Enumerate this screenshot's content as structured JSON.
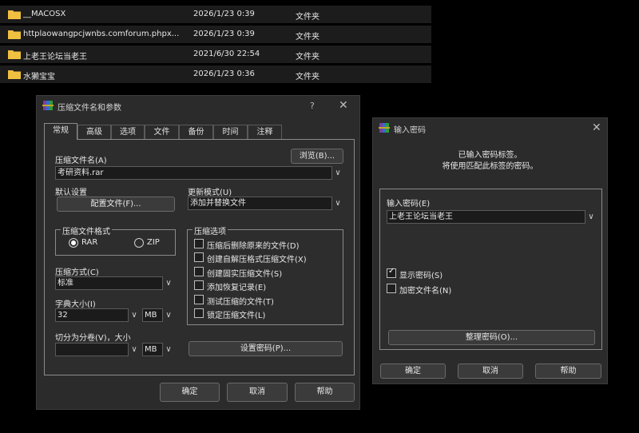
{
  "files": [
    {
      "name": "__MACOSX",
      "date": "2026/1/23 0:39",
      "type": "文件夹"
    },
    {
      "name": "httplaowangpcjwnbs.comforum.phpx...",
      "date": "2026/1/23 0:39",
      "type": "文件夹"
    },
    {
      "name": "上老王论坛当老王",
      "date": "2021/6/30 22:54",
      "type": "文件夹"
    },
    {
      "name": "水獭宝宝",
      "date": "2026/1/23 0:36",
      "type": "文件夹"
    }
  ],
  "archive": {
    "title": "压缩文件名和参数",
    "help": "?",
    "tabs": [
      "常规",
      "高级",
      "选项",
      "文件",
      "备份",
      "时间",
      "注释"
    ],
    "name_label": "压缩文件名(A)",
    "browse": "浏览(B)...",
    "name_value": "考研资料.rar",
    "default_label": "默认设置",
    "profiles": "配置文件(F)...",
    "update_label": "更新模式(U)",
    "update_value": "添加并替换文件",
    "format_label": "压缩文件格式",
    "format_rar": "RAR",
    "format_zip": "ZIP",
    "options_label": "压缩选项",
    "options": [
      "压缩后删除原来的文件(D)",
      "创建自解压格式压缩文件(X)",
      "创建固实压缩文件(S)",
      "添加恢复记录(E)",
      "测试压缩的文件(T)",
      "锁定压缩文件(L)"
    ],
    "method_label": "压缩方式(C)",
    "method_value": "标准",
    "dict_label": "字典大小(I)",
    "dict_value": "32",
    "dict_unit": "MB",
    "split_label": "切分为分卷(V)，大小",
    "split_unit": "MB",
    "set_password": "设置密码(P)...",
    "ok": "确定",
    "cancel": "取消",
    "helpbtn": "帮助"
  },
  "password": {
    "title": "输入密码",
    "info1": "已输入密码标签。",
    "info2": "将使用匹配此标签的密码。",
    "enter_label": "输入密码(E)",
    "value": "上老王论坛当老王",
    "show": "显示密码(S)",
    "encrypt": "加密文件名(N)",
    "organize": "整理密码(O)...",
    "ok": "确定",
    "cancel": "取消",
    "helpbtn": "帮助"
  },
  "colors": {
    "folder": "#f0c040",
    "bg": "#000000",
    "dialog": "#2b2b2b"
  }
}
